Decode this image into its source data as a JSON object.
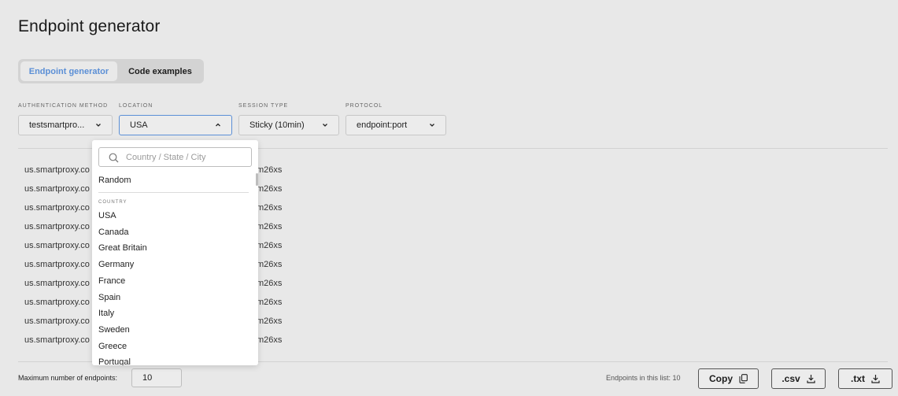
{
  "page": {
    "title": "Endpoint generator"
  },
  "tabs": [
    {
      "label": "Endpoint generator",
      "active": true
    },
    {
      "label": "Code examples",
      "active": false
    }
  ],
  "fields": {
    "auth": {
      "label": "Authentication method",
      "value": "testsmartpro..."
    },
    "location": {
      "label": "Location",
      "value": "USA"
    },
    "session": {
      "label": "Session type",
      "value": "Sticky (10min)"
    },
    "protocol": {
      "label": "Protocol",
      "value": "endpoint:port"
    }
  },
  "endpoints": {
    "prefix": "us.smartproxy.co",
    "suffix": "m26xs",
    "rows": 10
  },
  "dropdown": {
    "search_placeholder": "Country / State / City",
    "random_label": "Random",
    "section_label": "Country",
    "countries": [
      "USA",
      "Canada",
      "Great Britain",
      "Germany",
      "France",
      "Spain",
      "Italy",
      "Sweden",
      "Greece",
      "Portugal"
    ]
  },
  "footer": {
    "max_label": "Maximum number of endpoints:",
    "max_value": "10",
    "count_text": "Endpoints in this list: 10",
    "copy_label": "Copy",
    "csv_label": ".csv",
    "txt_label": ".txt"
  },
  "colors": {
    "accent": "#5b8fd6",
    "background": "#e8e8e8"
  }
}
